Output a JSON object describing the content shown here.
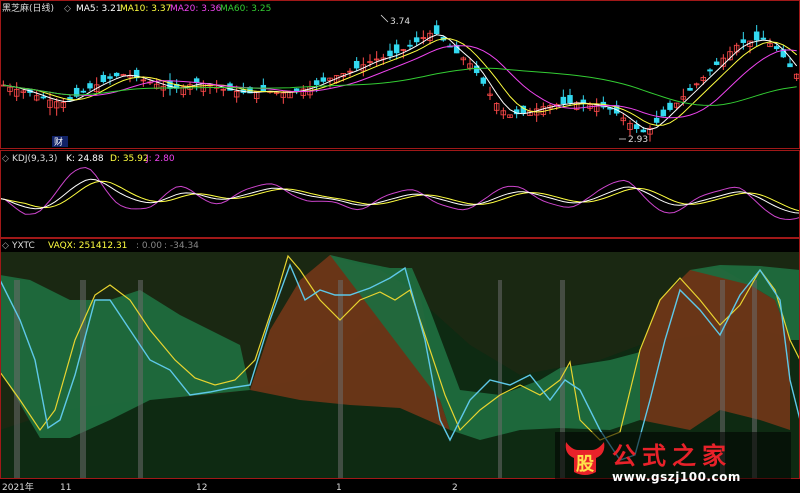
{
  "colors": {
    "up": "#ff4a4a",
    "down": "#33d9f0",
    "ma5": "#ffffff",
    "ma10": "#ffff40",
    "ma20": "#ee44ee",
    "ma60": "#33cc33",
    "kdj_k": "#ffffff",
    "kdj_d": "#ffff40",
    "kdj_j": "#cc44cc",
    "band_green": "#1f6b3e",
    "band_brown": "#6e3618",
    "yxtc_yellow": "#e8d430",
    "yxtc_cyan": "#5ec8e8",
    "grid_red": "#a01818"
  },
  "panel1": {
    "title": "黑芝麻(日线)",
    "ma5_label": "MA5: 3.21",
    "ma10_label": "MA10: 3.37",
    "ma20_label": "MA20: 3.36",
    "ma60_label": "MA60: 3.25",
    "high_mark": "3.74",
    "low_mark": "2.93",
    "note": "财"
  },
  "panel2": {
    "title": "KDJ(9,3,3)",
    "k_label": "K: 24.88",
    "d_label": "D: 35.92",
    "j_label": "J: 2.80"
  },
  "panel3": {
    "title": "YXTC",
    "vaqx_label": "VAQX: 251412.31",
    "v2_label": ": 0.00",
    "v3_label": ": -34.34"
  },
  "xaxis": {
    "labels": [
      "2021年",
      "11",
      "12",
      "1",
      "2"
    ]
  },
  "watermark": {
    "logo_char": "股",
    "title": "公式之家",
    "url": "www.gszj100.com"
  },
  "chart_data": [
    {
      "type": "candlestick",
      "title": "黑芝麻(日线)",
      "series_close": [
        3.3,
        3.28,
        3.26,
        3.25,
        3.22,
        3.2,
        3.18,
        3.17,
        3.19,
        3.23,
        3.27,
        3.3,
        3.33,
        3.36,
        3.38,
        3.37,
        3.35,
        3.33,
        3.31,
        3.29,
        3.27,
        3.28,
        3.3,
        3.32,
        3.31,
        3.29,
        3.27,
        3.26,
        3.25,
        3.24,
        3.25,
        3.26,
        3.25,
        3.24,
        3.25,
        3.26,
        3.28,
        3.3,
        3.33,
        3.36,
        3.38,
        3.4,
        3.43,
        3.46,
        3.49,
        3.5,
        3.52,
        3.55,
        3.58,
        3.62,
        3.66,
        3.7,
        3.64,
        3.58,
        3.52,
        3.48,
        3.4,
        3.3,
        3.2,
        3.12,
        3.08,
        3.09,
        3.1,
        3.12,
        3.14,
        3.15,
        3.16,
        3.17,
        3.17,
        3.16,
        3.15,
        3.14,
        3.12,
        3.08,
        3.03,
        2.98,
        2.95,
        3.0,
        3.06,
        3.12,
        3.18,
        3.24,
        3.3,
        3.36,
        3.42,
        3.48,
        3.54,
        3.6,
        3.62,
        3.63,
        3.64,
        3.6,
        3.55,
        3.45,
        3.38
      ],
      "annotations": [
        {
          "text": "3.74",
          "kind": "high"
        },
        {
          "text": "2.93",
          "kind": "low"
        }
      ]
    },
    {
      "type": "line",
      "title": "KDJ(9,3,3)",
      "k": [
        50,
        44,
        38,
        34,
        32,
        36,
        44,
        56,
        68,
        78,
        84,
        80,
        72,
        62,
        54,
        48,
        44,
        42,
        46,
        52,
        58,
        60,
        58,
        54,
        50,
        48,
        50,
        54,
        58,
        62,
        66,
        68,
        66,
        62,
        58,
        54,
        52,
        50,
        48,
        44,
        40,
        38,
        40,
        44,
        48,
        52,
        56,
        58,
        56,
        52,
        48,
        44,
        40,
        38,
        40,
        44,
        50,
        56,
        60,
        62,
        60,
        56,
        52,
        48,
        44,
        42,
        44,
        48,
        54,
        60,
        66,
        70,
        68,
        62,
        54,
        46,
        40,
        38,
        40,
        44,
        48,
        52,
        56,
        60,
        62,
        58,
        52,
        44,
        36,
        30,
        26,
        25
      ]
    },
    {
      "type": "area",
      "title": "YXTC",
      "series": [
        {
          "name": "VAQX",
          "values": [
            251412.31
          ]
        }
      ]
    }
  ]
}
